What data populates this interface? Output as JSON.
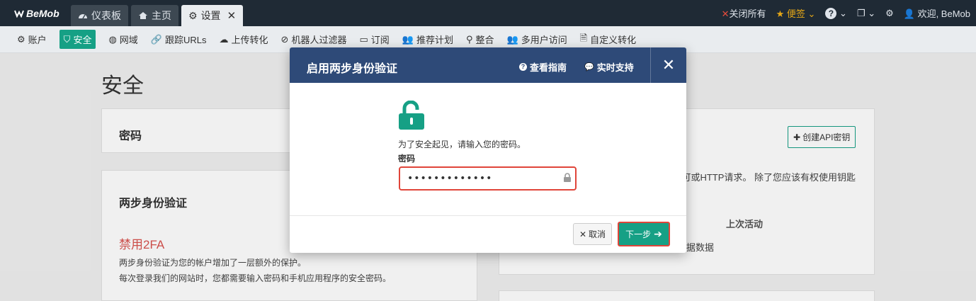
{
  "topbar": {
    "logo": "BeMob",
    "tabs": [
      {
        "label": "仪表板"
      },
      {
        "label": "主页"
      },
      {
        "label": "设置"
      }
    ],
    "close_all": "关闭所有",
    "bookmarks": "便签",
    "welcome": "欢迎, BeMob"
  },
  "subnav": {
    "items": [
      {
        "label": "账户"
      },
      {
        "label": "安全"
      },
      {
        "label": "网域"
      },
      {
        "label": "跟踪URLs"
      },
      {
        "label": "上传转化"
      },
      {
        "label": "机器人过滤器"
      },
      {
        "label": "订阅"
      },
      {
        "label": "推荐计划"
      },
      {
        "label": "整合"
      },
      {
        "label": "多用户访问"
      },
      {
        "label": "自定义转化"
      }
    ]
  },
  "page": {
    "title": "安全",
    "password_card_title": "密码",
    "twofa_card_title": "两步身份验证",
    "disable_2fa": "禁用2FA",
    "twofa_desc_1": "两步身份验证为您的帐户增加了一层额外的保护。",
    "twofa_desc_2": "每次登录我们的网站时，您都需要输入密码和手机应用程序的安全密码。",
    "create_api_key": "创建API密钥",
    "api_desc": "可或HTTP请求。 除了您应该有权使用钥匙",
    "last_activity_header": "上次活动",
    "no_data": "据数据"
  },
  "modal": {
    "title": "启用两步身份验证",
    "guide_link": "查看指南",
    "support_link": "实时支持",
    "intro": "为了安全起见，请输入您的密码。",
    "password_label": "密码",
    "password_value": "•••••••••••••",
    "cancel_label": "取消",
    "next_label": "下一步"
  },
  "colors": {
    "topbar_bg": "#1f2a35",
    "accent": "#16a085",
    "modal_header": "#2e4a78",
    "danger": "#d9534f"
  }
}
